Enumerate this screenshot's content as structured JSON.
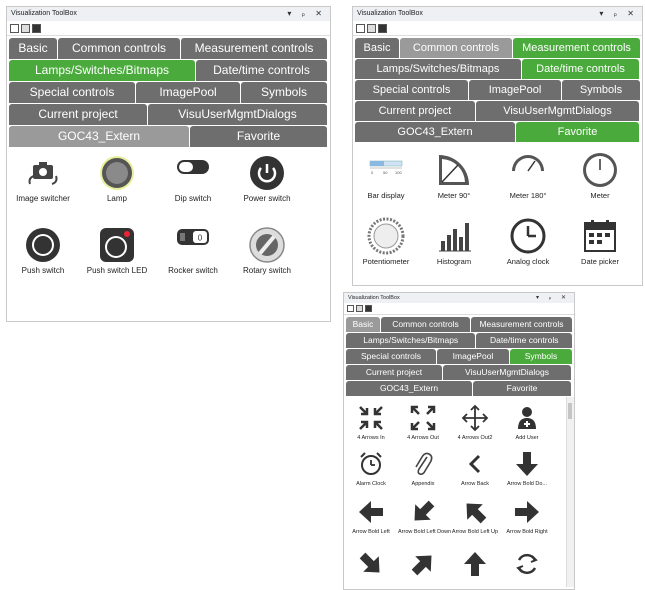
{
  "colors": {
    "tab_gray": "#6e6e6e",
    "tab_green": "#4aab3c",
    "tab_light": "#9a9a9a"
  },
  "panel_a": {
    "title": "Visualization ToolBox",
    "controls": "▾ ₚ ✕",
    "tabs": [
      [
        "Basic",
        "Common controls",
        "Measurement controls"
      ],
      [
        "Lamps/Switches/Bitmaps",
        "Date/time controls"
      ],
      [
        "Special controls",
        "ImagePool",
        "Symbols"
      ],
      [
        "Current project",
        "VisuUserMgmtDialogs"
      ],
      [
        "GOC43_Extern",
        "Favorite"
      ]
    ],
    "items": [
      {
        "label": "Image switcher",
        "icon": "image-switcher-icon"
      },
      {
        "label": "Lamp",
        "icon": "lamp-icon"
      },
      {
        "label": "Dip switch",
        "icon": "dip-switch-icon"
      },
      {
        "label": "Power switch",
        "icon": "power-switch-icon"
      },
      {
        "label": "Push switch",
        "icon": "push-switch-icon"
      },
      {
        "label": "Push switch LED",
        "icon": "push-switch-led-icon"
      },
      {
        "label": "Rocker switch",
        "icon": "rocker-switch-icon"
      },
      {
        "label": "Rotary switch",
        "icon": "rotary-switch-icon"
      }
    ]
  },
  "panel_b": {
    "title": "Visualization ToolBox",
    "controls": "▾ ₚ ✕",
    "tabs": [
      [
        "Basic",
        "Common controls",
        "Measurement controls"
      ],
      [
        "Lamps/Switches/Bitmaps",
        "Date/time controls"
      ],
      [
        "Special controls",
        "ImagePool",
        "Symbols"
      ],
      [
        "Current project",
        "VisuUserMgmtDialogs"
      ],
      [
        "GOC43_Extern",
        "Favorite"
      ]
    ],
    "bar_ticks": [
      "0",
      "50",
      "100"
    ],
    "items": [
      {
        "label": "Bar display",
        "icon": "bar-display-icon"
      },
      {
        "label": "Meter 90°",
        "icon": "meter-90-icon"
      },
      {
        "label": "Meter 180°",
        "icon": "meter-180-icon"
      },
      {
        "label": "Meter",
        "icon": "meter-icon"
      },
      {
        "label": "Potentiometer",
        "icon": "potentiometer-icon"
      },
      {
        "label": "Histogram",
        "icon": "histogram-icon"
      },
      {
        "label": "Analog clock",
        "icon": "analog-clock-icon"
      },
      {
        "label": "Date picker",
        "icon": "date-picker-icon"
      }
    ]
  },
  "panel_c": {
    "title": "Visualization ToolBox",
    "controls": "▾ ₚ ✕",
    "tabs": [
      [
        "Basic",
        "Common controls",
        "Measurement controls"
      ],
      [
        "Lamps/Switches/Bitmaps",
        "Date/time controls"
      ],
      [
        "Special controls",
        "ImagePool",
        "Symbols"
      ],
      [
        "Current project",
        "VisuUserMgmtDialogs"
      ],
      [
        "GOC43_Extern",
        "Favorite"
      ]
    ],
    "items": [
      {
        "label": "4 Arrows In",
        "icon": "arrows-in-icon"
      },
      {
        "label": "4 Arrows Out",
        "icon": "arrows-out-icon"
      },
      {
        "label": "4 Arrows Out2",
        "icon": "arrows-out2-icon"
      },
      {
        "label": "Add User",
        "icon": "add-user-icon"
      },
      {
        "label": "Alarm Clock",
        "icon": "alarm-clock-icon"
      },
      {
        "label": "Appendix",
        "icon": "paperclip-icon"
      },
      {
        "label": "Arrow Back",
        "icon": "arrow-back-icon"
      },
      {
        "label": "Arrow Bold Do...",
        "icon": "arrow-bold-down-icon"
      },
      {
        "label": "Arrow Bold Left",
        "icon": "arrow-bold-left-icon"
      },
      {
        "label": "Arrow Bold Left Down",
        "icon": "arrow-bold-left-down-icon"
      },
      {
        "label": "Arrow Bold Left Up",
        "icon": "arrow-bold-left-up-icon"
      },
      {
        "label": "Arrow Bold Right",
        "icon": "arrow-bold-right-icon"
      },
      {
        "label": "",
        "icon": "arrow-bold-right-down-icon"
      },
      {
        "label": "",
        "icon": "arrow-bold-right-up-icon"
      },
      {
        "label": "",
        "icon": "arrow-bold-up-icon"
      },
      {
        "label": "",
        "icon": "refresh-icon"
      }
    ]
  }
}
